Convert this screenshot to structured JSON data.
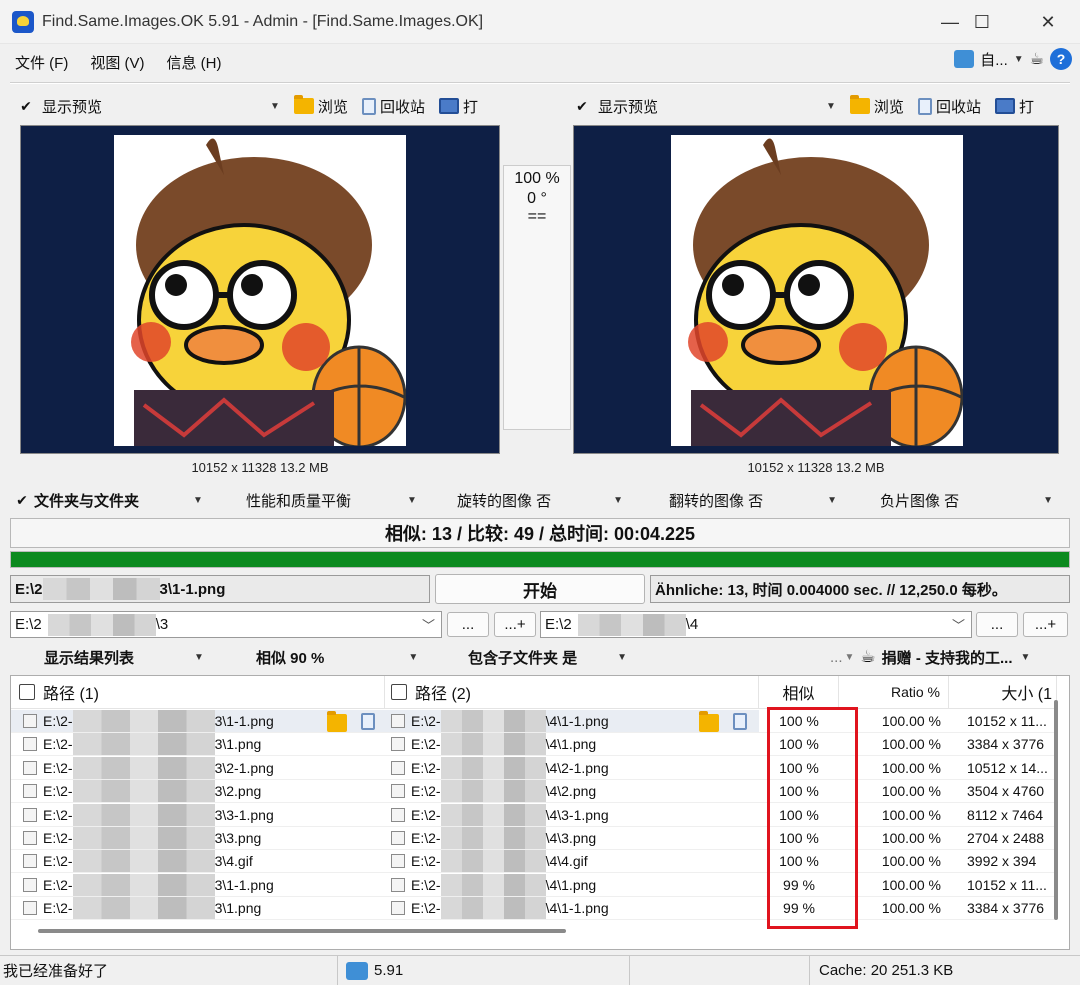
{
  "window": {
    "title": "Find.Same.Images.OK 5.91 - Admin - [Find.Same.Images.OK]",
    "minimize": "—",
    "maximize": "☐",
    "close": "✕"
  },
  "menu": {
    "items": [
      "文件 (F)",
      "视图 (V)",
      "信息 (H)"
    ],
    "right_label": "自...",
    "help": "?"
  },
  "preview_left": {
    "show_preview": "显示预览",
    "browse": "浏览",
    "recycle": "回收站",
    "open": "打",
    "caption": "10152 x 11328 13.2 MB"
  },
  "preview_right": {
    "show_preview": "显示预览",
    "browse": "浏览",
    "recycle": "回收站",
    "open": "打",
    "caption": "10152 x 11328 13.2 MB"
  },
  "compare_info": {
    "similarity": "100 %",
    "angle": "0 °",
    "equal": "=="
  },
  "options": {
    "folders": "文件夹与文件夹",
    "quality": "性能和质量平衡",
    "rotated": "旋转的图像 否",
    "flipped": "翻转的图像 否",
    "negative": "负片图像 否"
  },
  "summary": "相似: 13 / 比较: 49 / 总时间: 00:04.225",
  "progress": 1.0,
  "current_file": {
    "prefix": "E:\\2",
    "suffix": "3\\1-1.png"
  },
  "start_button": "开始",
  "stats": "Ähnliche: 13, 时间 0.004000 sec. // 12,250.0 每秒。",
  "path_left": {
    "prefix": "E:\\2",
    "suffix": "\\3"
  },
  "path_right": {
    "prefix": "E:\\2",
    "suffix": "\\4"
  },
  "dots": "...",
  "dots_plus": "...+",
  "list_options": {
    "show_results": "显示结果列表",
    "similar": "相似 90 %",
    "subfolders": "包含子文件夹 是",
    "donate": "捐赠 - 支持我的工...",
    "more": "..."
  },
  "table": {
    "headers": {
      "path1": "路径 (1)",
      "path2": "路径 (2)",
      "similar": "相似",
      "ratio": "Ratio %",
      "size": "大小 (1"
    },
    "rows": [
      {
        "p1_prefix": "E:\\2-",
        "p1": "3\\1-1.png",
        "p2_prefix": "E:\\2-",
        "p2": "\\4\\1-1.png",
        "sim": "100 %",
        "ratio": "100.00 %",
        "size": "10152 x 11..."
      },
      {
        "p1_prefix": "E:\\2-",
        "p1": "3\\1.png",
        "p2_prefix": "E:\\2-",
        "p2": "\\4\\1.png",
        "sim": "100 %",
        "ratio": "100.00 %",
        "size": "3384 x 3776"
      },
      {
        "p1_prefix": "E:\\2-",
        "p1": "3\\2-1.png",
        "p2_prefix": "E:\\2-",
        "p2": "\\4\\2-1.png",
        "sim": "100 %",
        "ratio": "100.00 %",
        "size": "10512 x 14..."
      },
      {
        "p1_prefix": "E:\\2-",
        "p1": "3\\2.png",
        "p2_prefix": "E:\\2-",
        "p2": "\\4\\2.png",
        "sim": "100 %",
        "ratio": "100.00 %",
        "size": "3504 x 4760"
      },
      {
        "p1_prefix": "E:\\2-",
        "p1": "3\\3-1.png",
        "p2_prefix": "E:\\2-",
        "p2": "\\4\\3-1.png",
        "sim": "100 %",
        "ratio": "100.00 %",
        "size": "8112 x 7464"
      },
      {
        "p1_prefix": "E:\\2-",
        "p1": "3\\3.png",
        "p2_prefix": "E:\\2-",
        "p2": "\\4\\3.png",
        "sim": "100 %",
        "ratio": "100.00 %",
        "size": "2704 x 2488"
      },
      {
        "p1_prefix": "E:\\2-",
        "p1": "3\\4.gif",
        "p2_prefix": "E:\\2-",
        "p2": "\\4\\4.gif",
        "sim": "100 %",
        "ratio": "100.00 %",
        "size": "3992 x 394"
      },
      {
        "p1_prefix": "E:\\2-",
        "p1": "3\\1-1.png",
        "p2_prefix": "E:\\2-",
        "p2": "\\4\\1.png",
        "sim": "99 %",
        "ratio": "100.00 %",
        "size": "10152 x 11..."
      },
      {
        "p1_prefix": "E:\\2-",
        "p1": "3\\1.png",
        "p2_prefix": "E:\\2-",
        "p2": "\\4\\1-1.png",
        "sim": "99 %",
        "ratio": "100.00 %",
        "size": "3384 x 3776"
      }
    ]
  },
  "statusbar": {
    "ready": "我已经准备好了",
    "version": "5.91",
    "cache": "Cache: 20 251.3 KB"
  },
  "colors": {
    "preview_bg": "#0e1f45",
    "progress": "#0c8a1f",
    "highlight": "#e0141e"
  }
}
